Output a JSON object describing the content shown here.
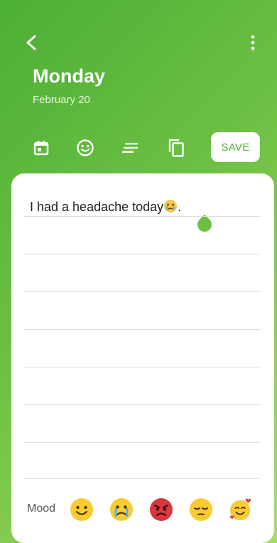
{
  "header": {
    "title": "Monday",
    "date": "February 20",
    "back_icon": "back-arrow-icon",
    "more_icon": "more-vert-icon"
  },
  "toolbar": {
    "icons": [
      "calendar-icon",
      "emoji-icon",
      "text-format-icon",
      "copy-icon"
    ],
    "save_label": "SAVE"
  },
  "entry": {
    "text": "I had a headache today",
    "text_emoji": "crying-face",
    "trailing": "."
  },
  "mood": {
    "label": "Mood",
    "options": [
      "smiling-face",
      "crying-face",
      "angry-face",
      "pensive-face",
      "smiling-face-with-hearts"
    ]
  },
  "colors": {
    "accent": "#4caf35",
    "gradient_end": "#a8dd63",
    "card": "#ffffff"
  }
}
